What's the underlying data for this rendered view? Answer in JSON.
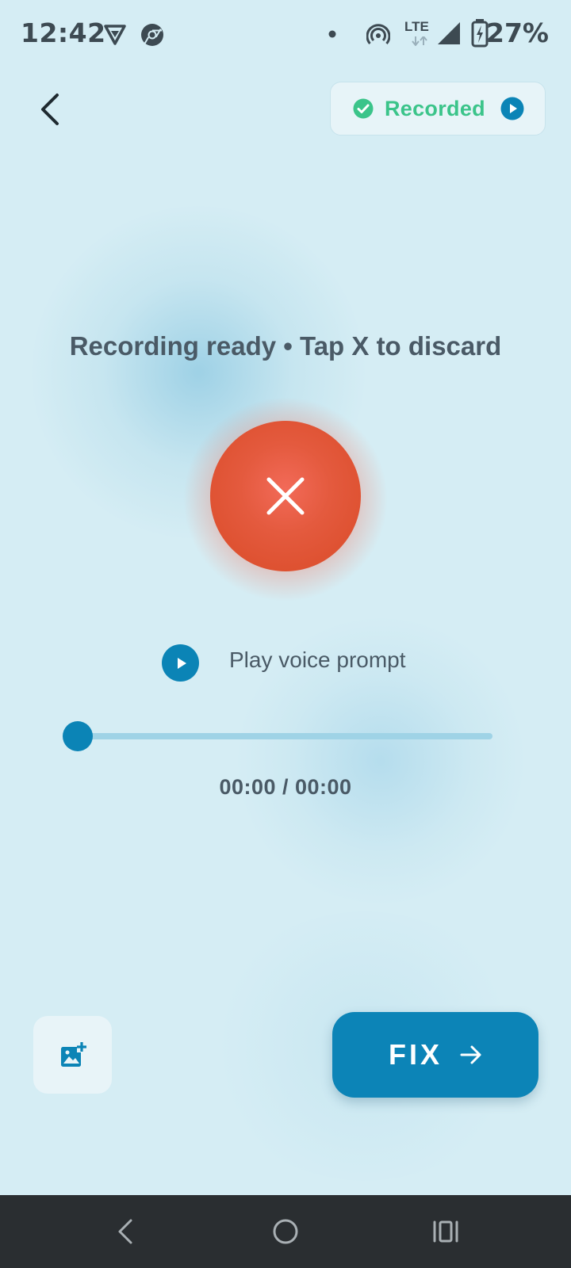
{
  "status_bar": {
    "time": "12:42",
    "network": "LTE",
    "battery": "27%",
    "icons": [
      "vpn-shield-icon",
      "chrome-icon",
      "dot-icon",
      "hotspot-icon",
      "lte-icon",
      "signal-icon",
      "battery-charging-icon"
    ]
  },
  "header": {
    "back_icon": "chevron-left-icon",
    "chip_label": "Recorded",
    "chip_icons": [
      "check-circle-icon",
      "play-circle-icon"
    ]
  },
  "main": {
    "status_text": "Recording ready • Tap X to discard",
    "discard_icon": "close-icon",
    "play_prompt_label": "Play voice prompt",
    "playback_progress": 0,
    "time_readout": "00:00 / 00:00"
  },
  "actions": {
    "add_image_icon": "add-photo-icon",
    "fix_label": "FIX",
    "fix_icon": "arrow-right-icon"
  },
  "nav_bar": {
    "icons": [
      "nav-back-icon",
      "nav-home-icon",
      "nav-recents-icon"
    ]
  },
  "colors": {
    "background": "#d5edf4",
    "accent": "#0c84b7",
    "success": "#3bc48a",
    "discard": "#e45a3e",
    "text": "#4a5a66"
  }
}
